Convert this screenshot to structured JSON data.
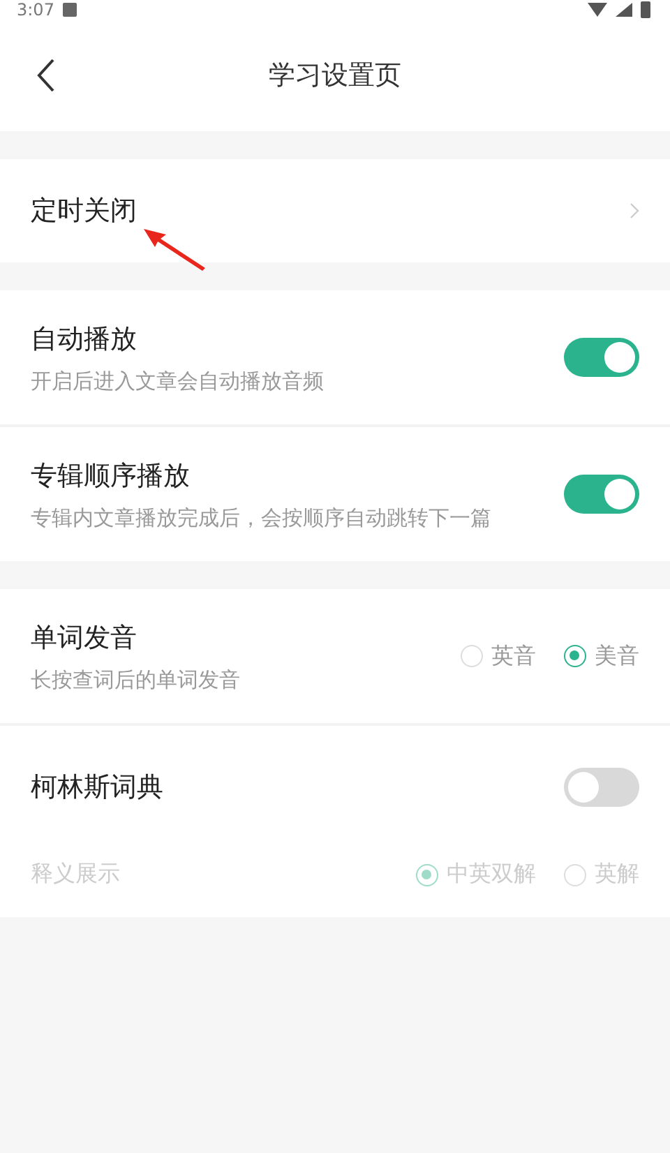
{
  "status_bar": {
    "time": "3:07"
  },
  "header": {
    "title": "学习设置页"
  },
  "sections": [
    {
      "rows": [
        {
          "kind": "link",
          "title": "定时关闭"
        }
      ]
    },
    {
      "rows": [
        {
          "kind": "switch",
          "title": "自动播放",
          "subtitle": "开启后进入文章会自动播放音频",
          "on": true
        },
        {
          "kind": "switch",
          "title": "专辑顺序播放",
          "subtitle": "专辑内文章播放完成后，会按顺序自动跳转下一篇",
          "on": true
        }
      ]
    },
    {
      "rows": [
        {
          "kind": "radio",
          "title": "单词发音",
          "subtitle": "长按查词后的单词发音",
          "options": [
            {
              "label": "英音",
              "selected": false
            },
            {
              "label": "美音",
              "selected": true
            }
          ]
        },
        {
          "kind": "switch_options",
          "title": "柯林斯词典",
          "on": false,
          "sub_label": "释义展示",
          "disabled": true,
          "options": [
            {
              "label": "中英双解",
              "selected": true
            },
            {
              "label": "英解",
              "selected": false
            }
          ]
        }
      ]
    }
  ],
  "annotation": {
    "kind": "arrow"
  }
}
